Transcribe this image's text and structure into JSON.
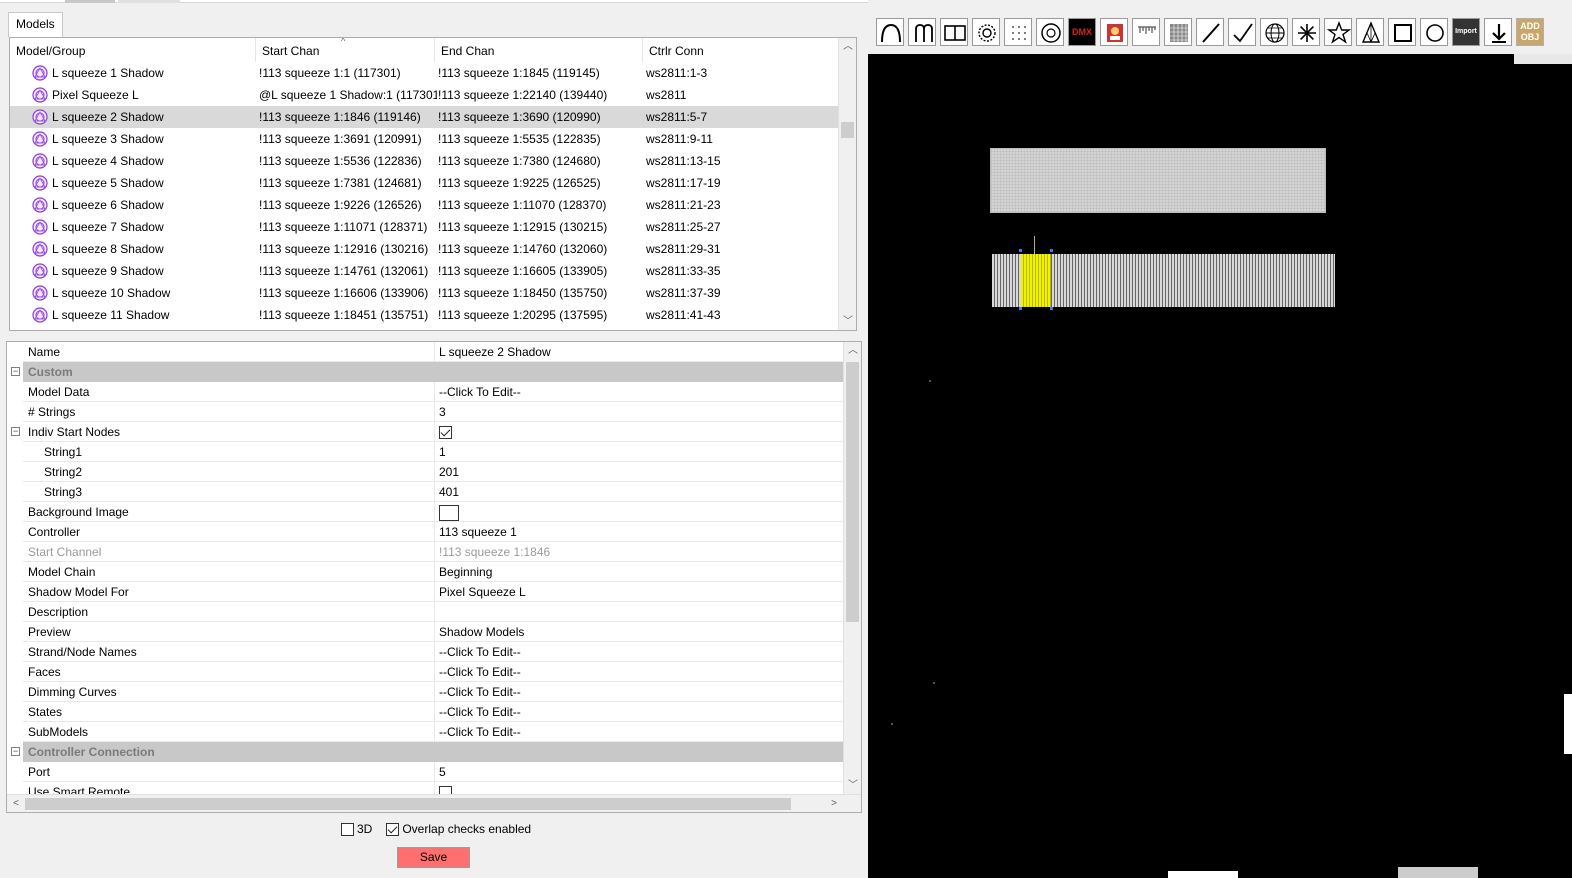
{
  "tabs": {
    "models_tab": "Models"
  },
  "models": {
    "headers": [
      "Model/Group",
      "Start Chan",
      "End Chan",
      "Ctrlr Conn"
    ],
    "sort_indicator": "^",
    "rows": [
      {
        "name": "L squeeze 1 Shadow",
        "start": "!113 squeeze 1:1 (117301)",
        "end": "!113 squeeze 1:1845 (119145)",
        "conn": "ws2811:1-3"
      },
      {
        "name": "Pixel Squeeze L",
        "start": "@L squeeze 1 Shadow:1 (117301)",
        "end": "!113 squeeze 1:22140 (139440)",
        "conn": "ws2811"
      },
      {
        "name": "L squeeze 2 Shadow",
        "start": "!113 squeeze 1:1846 (119146)",
        "end": "!113 squeeze 1:3690 (120990)",
        "conn": "ws2811:5-7",
        "selected": true
      },
      {
        "name": "L squeeze 3 Shadow",
        "start": "!113 squeeze 1:3691 (120991)",
        "end": "!113 squeeze 1:5535 (122835)",
        "conn": "ws2811:9-11"
      },
      {
        "name": "L squeeze 4 Shadow",
        "start": "!113 squeeze 1:5536 (122836)",
        "end": "!113 squeeze 1:7380 (124680)",
        "conn": "ws2811:13-15"
      },
      {
        "name": "L squeeze 5 Shadow",
        "start": "!113 squeeze 1:7381 (124681)",
        "end": "!113 squeeze 1:9225 (126525)",
        "conn": "ws2811:17-19"
      },
      {
        "name": "L squeeze 6 Shadow",
        "start": "!113 squeeze 1:9226 (126526)",
        "end": "!113 squeeze 1:11070 (128370)",
        "conn": "ws2811:21-23"
      },
      {
        "name": "L squeeze 7 Shadow",
        "start": "!113 squeeze 1:11071 (128371)",
        "end": "!113 squeeze 1:12915 (130215)",
        "conn": "ws2811:25-27"
      },
      {
        "name": "L squeeze 8 Shadow",
        "start": "!113 squeeze 1:12916 (130216)",
        "end": "!113 squeeze 1:14760 (132060)",
        "conn": "ws2811:29-31"
      },
      {
        "name": "L squeeze 9 Shadow",
        "start": "!113 squeeze 1:14761 (132061)",
        "end": "!113 squeeze 1:16605 (133905)",
        "conn": "ws2811:33-35"
      },
      {
        "name": "L squeeze 10 Shadow",
        "start": "!113 squeeze 1:16606 (133906)",
        "end": "!113 squeeze 1:18450 (135750)",
        "conn": "ws2811:37-39"
      },
      {
        "name": "L squeeze 11 Shadow",
        "start": "!113 squeeze 1:18451 (135751)",
        "end": "!113 squeeze 1:20295 (137595)",
        "conn": "ws2811:41-43"
      }
    ]
  },
  "properties": {
    "rows": [
      {
        "type": "prop",
        "label": "Name",
        "value": "L squeeze 2 Shadow"
      },
      {
        "type": "cat",
        "label": "Custom",
        "expander": "⊟"
      },
      {
        "type": "prop",
        "label": "Model Data",
        "value": "--Click To Edit--"
      },
      {
        "type": "prop",
        "label": "# Strings",
        "value": "3"
      },
      {
        "type": "prop",
        "label": "Indiv Start Nodes",
        "check": true,
        "expander": "⊟"
      },
      {
        "type": "prop",
        "label": "String1",
        "value": "1",
        "indent": true
      },
      {
        "type": "prop",
        "label": "String2",
        "value": "201",
        "indent": true
      },
      {
        "type": "prop",
        "label": "String3",
        "value": "401",
        "indent": true
      },
      {
        "type": "prop",
        "label": "Background Image",
        "box": true
      },
      {
        "type": "prop",
        "label": "Controller",
        "value": "113 squeeze 1"
      },
      {
        "type": "prop",
        "label": "Start Channel",
        "value": "!113 squeeze 1:1846",
        "disabled": true
      },
      {
        "type": "prop",
        "label": "Model Chain",
        "value": "Beginning"
      },
      {
        "type": "prop",
        "label": "Shadow Model For",
        "value": "Pixel Squeeze L"
      },
      {
        "type": "prop",
        "label": "Description",
        "value": ""
      },
      {
        "type": "prop",
        "label": "Preview",
        "value": "Shadow Models"
      },
      {
        "type": "prop",
        "label": "Strand/Node Names",
        "value": "--Click To Edit--"
      },
      {
        "type": "prop",
        "label": "Faces",
        "value": "--Click To Edit--"
      },
      {
        "type": "prop",
        "label": "Dimming Curves",
        "value": "--Click To Edit--"
      },
      {
        "type": "prop",
        "label": "States",
        "value": "--Click To Edit--"
      },
      {
        "type": "prop",
        "label": "SubModels",
        "value": "--Click To Edit--"
      },
      {
        "type": "cat",
        "label": "Controller Connection",
        "expander": "⊟"
      },
      {
        "type": "prop",
        "label": "Port",
        "value": "5"
      },
      {
        "type": "prop",
        "label": "Use Smart Remote",
        "check": false
      }
    ]
  },
  "options": {
    "three_d": "3D",
    "three_d_checked": false,
    "overlap": "Overlap checks enabled",
    "overlap_checked": true
  },
  "save_button": "Save",
  "toolbar_icons": [
    "arch-icon",
    "candy-cane-icon",
    "window-frame-icon",
    "circle-icon",
    "matrix-icon",
    "custom-model-icon",
    "dmx-icon",
    "image-icon",
    "icicles-icon",
    "grid-matrix-icon",
    "single-line-icon",
    "poly-line-icon",
    "sphere-icon",
    "spinner-icon",
    "star-icon",
    "tree-icon",
    "cube-icon",
    "wreath-icon",
    "import-icon",
    "download-icon",
    "add-object-icon"
  ],
  "toolbar_text": {
    "dmx": "DMX",
    "import": "Import",
    "add_obj_1": "ADD",
    "add_obj_2": "OBJ"
  },
  "colors": {
    "selected_row": "#d9d9d9",
    "save": "#ff6f6f",
    "highlight": "#e1e100",
    "category": "#c8c8c8"
  }
}
